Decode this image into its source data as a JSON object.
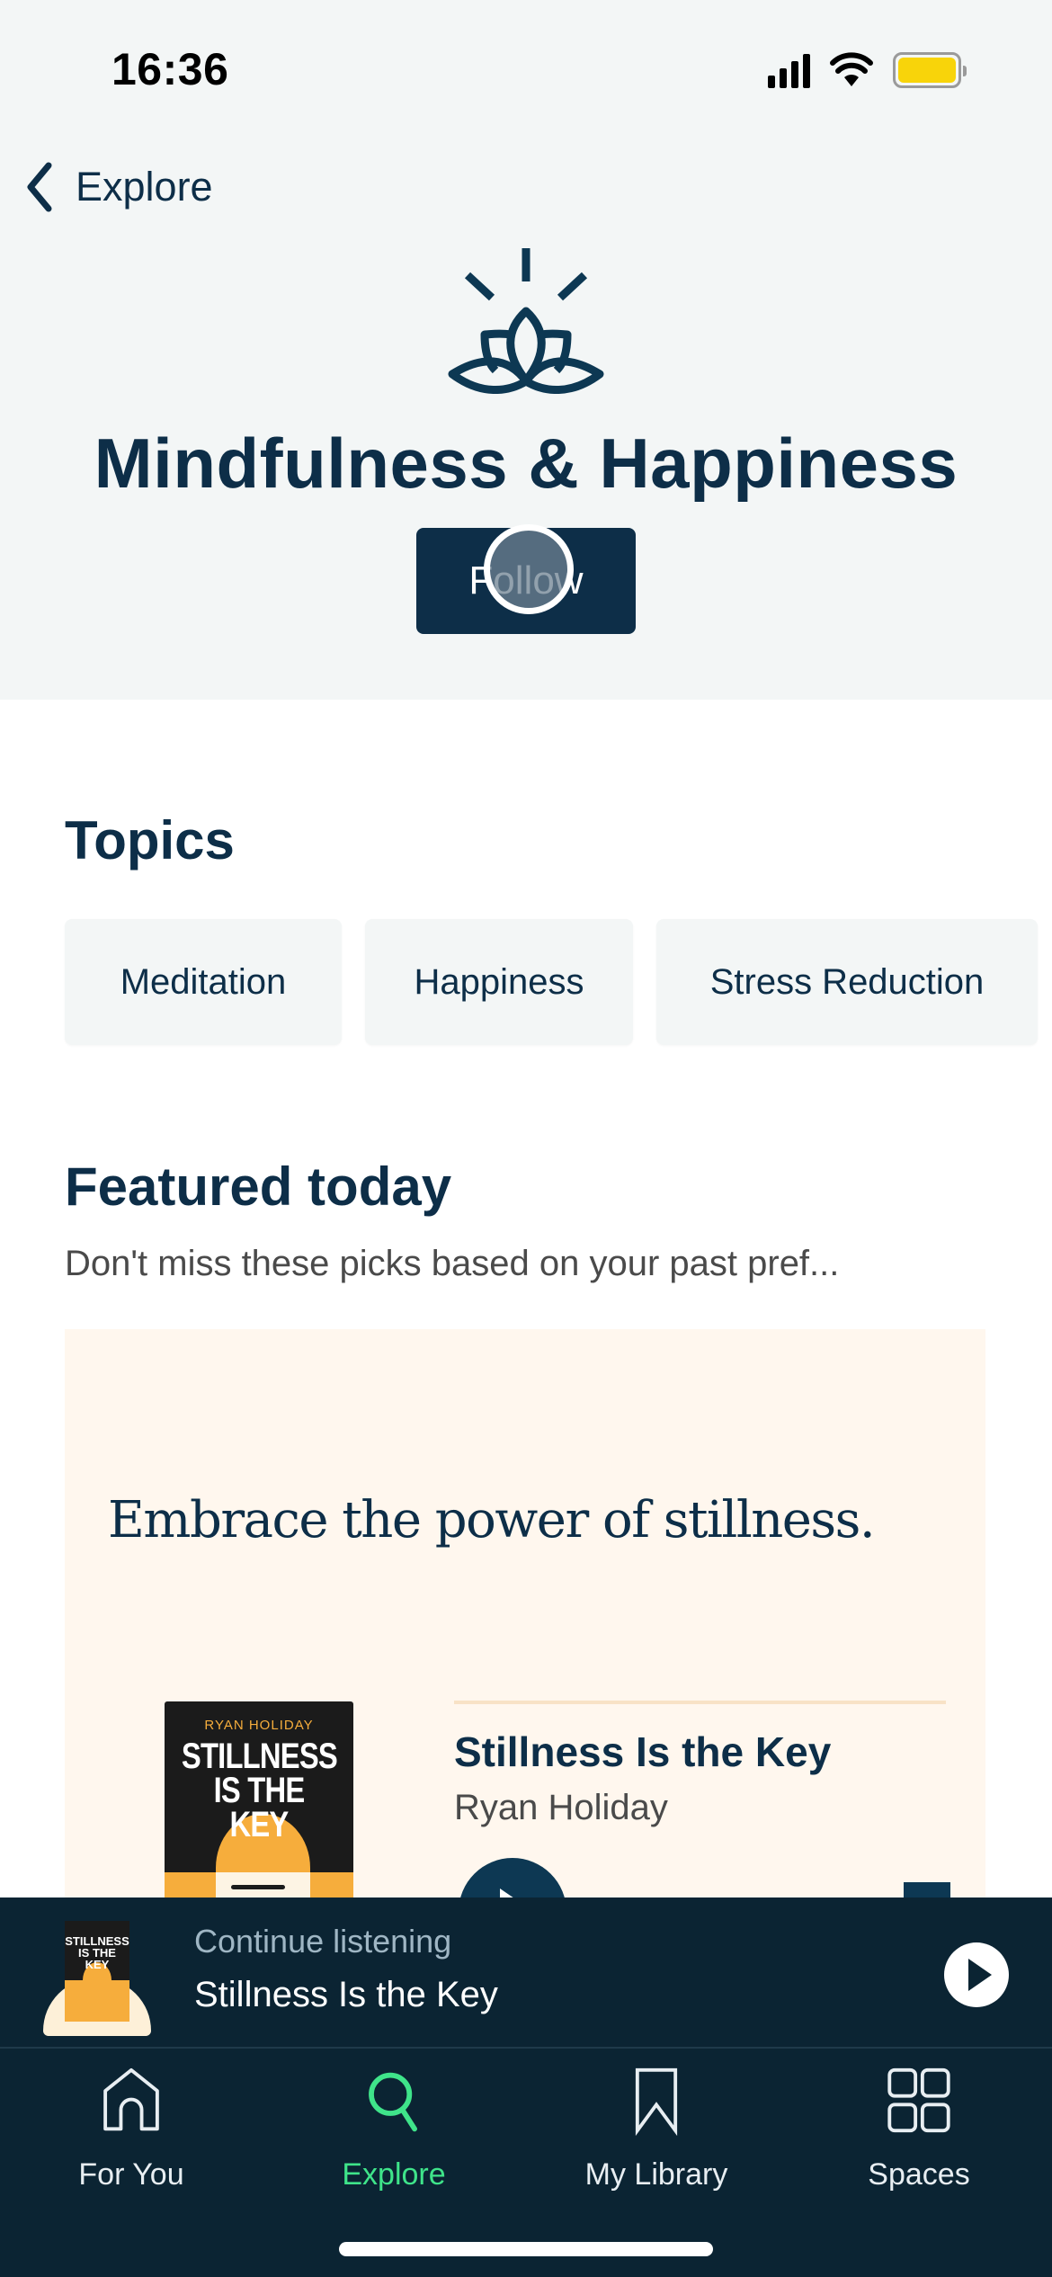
{
  "status_bar": {
    "time": "16:36"
  },
  "nav": {
    "back_label": "Explore"
  },
  "header": {
    "icon": "lotus-icon",
    "title": "Mindfulness & Happiness",
    "follow_label": "Follow"
  },
  "topics": {
    "title": "Topics",
    "items": [
      {
        "label": "Meditation"
      },
      {
        "label": "Happiness"
      },
      {
        "label": "Stress Reduction"
      }
    ]
  },
  "featured": {
    "title": "Featured today",
    "subtitle": "Don't miss these picks based on your past pref...",
    "card": {
      "quote": "Embrace the power of stillness.",
      "book_title": "Stillness Is the Key",
      "book_author": "Ryan Holiday",
      "cover_author": "RYAN HOLIDAY",
      "cover_title_line1": "STILLNESS",
      "cover_title_line2": "IS THE KEY"
    }
  },
  "mini_player": {
    "label": "Continue listening",
    "title": "Stillness Is the Key",
    "cover_title_line1": "STILLNESS",
    "cover_title_line2": "IS THE KEY"
  },
  "tab_bar": {
    "items": [
      {
        "label": "For You",
        "icon": "home-icon",
        "active": false
      },
      {
        "label": "Explore",
        "icon": "search-icon",
        "active": true
      },
      {
        "label": "My Library",
        "icon": "bookmark-icon",
        "active": false
      },
      {
        "label": "Spaces",
        "icon": "grid-icon",
        "active": false
      }
    ]
  },
  "colors": {
    "primary": "#0d2e48",
    "header_bg": "#f3f6f6",
    "card_bg": "#fff7ee",
    "player_bg": "#0b2433",
    "active_tab": "#3fe48a",
    "cover_accent": "#f6ad3c"
  }
}
